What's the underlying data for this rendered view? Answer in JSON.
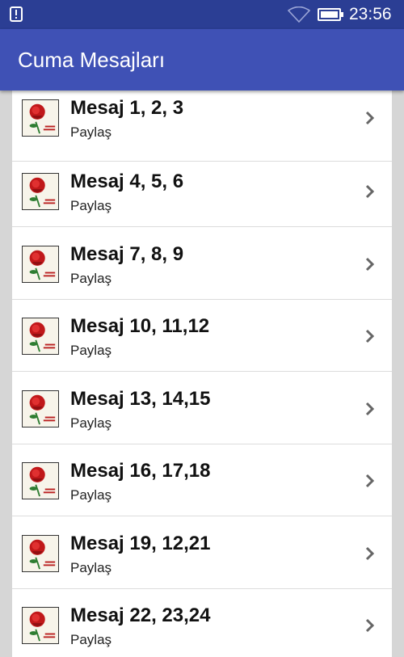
{
  "status_bar": {
    "time": "23:56",
    "icons": [
      "notification-alert-icon",
      "wifi-icon",
      "battery-icon"
    ]
  },
  "app_bar": {
    "title": "Cuma Mesajları"
  },
  "list": {
    "items": [
      {
        "title": "Mesaj  1, 2, 3",
        "subtitle": "Paylaş"
      },
      {
        "title": "Mesaj  4, 5, 6",
        "subtitle": "Paylaş"
      },
      {
        "title": "Mesaj  7, 8, 9",
        "subtitle": "Paylaş"
      },
      {
        "title": "Mesaj  10, 11,12",
        "subtitle": "Paylaş"
      },
      {
        "title": "Mesaj  13, 14,15",
        "subtitle": "Paylaş"
      },
      {
        "title": "Mesaj  16, 17,18",
        "subtitle": "Paylaş"
      },
      {
        "title": "Mesaj  19, 12,21",
        "subtitle": "Paylaş"
      },
      {
        "title": "Mesaj  22, 23,24",
        "subtitle": "Paylaş"
      }
    ]
  },
  "colors": {
    "status_bar": "#2b3e94",
    "app_bar": "#3f51b5",
    "background": "#d6d6d6",
    "rose": "#c0181a"
  }
}
